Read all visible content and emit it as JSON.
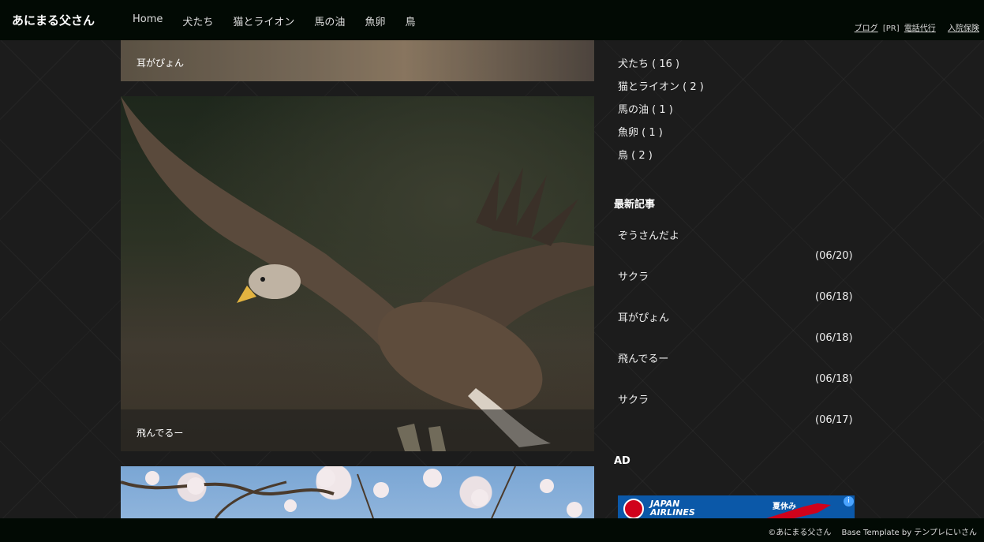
{
  "site": {
    "title": "あにまる父さん"
  },
  "nav": [
    "Home",
    "犬たち",
    "猫とライオン",
    "馬の油",
    "魚卵",
    "鳥"
  ],
  "toplinks": {
    "blog": "ブログ",
    "pr": "[PR]",
    "phone": "電話代行",
    "hospital": "入院保険"
  },
  "posts": [
    {
      "caption": "耳がぴょん"
    },
    {
      "caption": "飛んでるー"
    }
  ],
  "categories": [
    "犬たち ( 16 )",
    "猫とライオン ( 2 )",
    "馬の油 ( 1 )",
    "魚卵 ( 1 )",
    "鳥 ( 2 )"
  ],
  "recent": {
    "title": "最新記事",
    "items": [
      {
        "title": "ぞうさんだよ",
        "date": "(06/20)"
      },
      {
        "title": "サクラ",
        "date": "(06/18)"
      },
      {
        "title": "耳がぴょん",
        "date": "(06/18)"
      },
      {
        "title": "飛んでるー",
        "date": "(06/18)"
      },
      {
        "title": "サクラ",
        "date": "(06/17)"
      }
    ]
  },
  "ad": {
    "title": "AD",
    "brand_line1": "JAPAN",
    "brand_line2": "AIRLINES",
    "promo": "夏休み",
    "info": "i"
  },
  "footer": {
    "copyright": "©あにまる父さん",
    "template": "Base Template by テンプレにいさん"
  }
}
